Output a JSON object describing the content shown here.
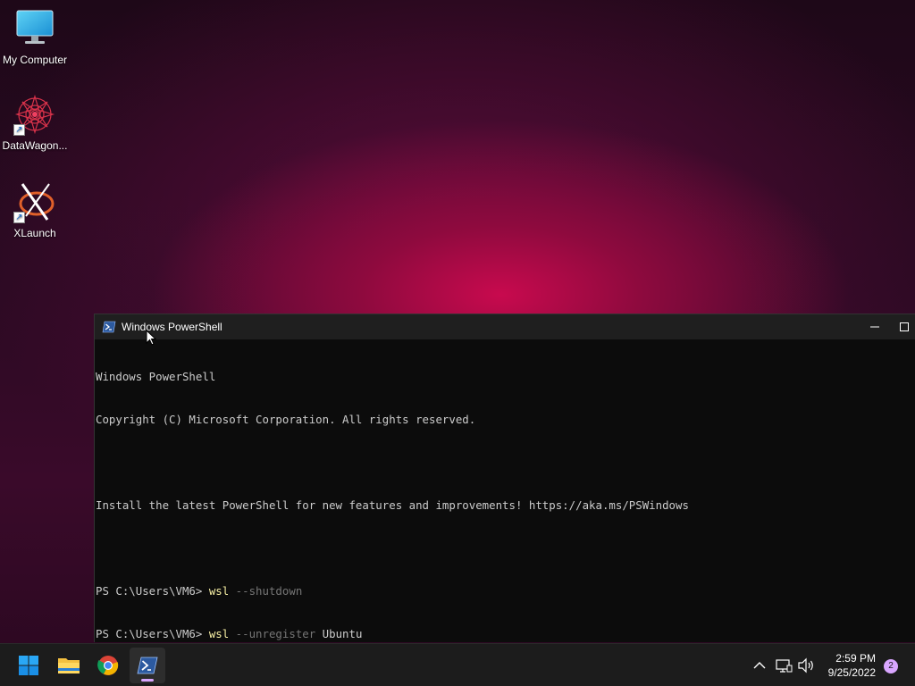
{
  "desktop": {
    "icons": [
      {
        "label": "My Computer",
        "icon": "monitor-icon"
      },
      {
        "label": "DataWagon...",
        "icon": "mandala-icon"
      },
      {
        "label": "XLaunch",
        "icon": "xlaunch-icon"
      }
    ]
  },
  "window": {
    "title": "Windows PowerShell",
    "minimize_glyph": "—",
    "maximize_glyph": "☐"
  },
  "console": {
    "lines": [
      "Windows PowerShell",
      "Copyright (C) Microsoft Corporation. All rights reserved.",
      "",
      "Install the latest PowerShell for new features and improvements! https://aka.ms/PSWindows",
      ""
    ],
    "commands": [
      {
        "prompt": "PS C:\\Users\\VM6> ",
        "cmd": "wsl",
        "arg": " --shutdown",
        "value": ""
      },
      {
        "prompt": "PS C:\\Users\\VM6> ",
        "cmd": "wsl",
        "arg": " --unregister",
        "value": " Ubuntu"
      }
    ]
  },
  "taskbar": {
    "apps": [
      "start-icon",
      "file-explorer-icon",
      "chrome-icon",
      "powershell-icon"
    ],
    "tray": {
      "chevron": "^",
      "time": "2:59 PM",
      "date": "9/25/2022",
      "notification_count": "2"
    }
  },
  "colors": {
    "accent": "#d9a6ff",
    "console_bg": "#0c0c0c",
    "command": "#f9f1a5",
    "argument": "#767676"
  }
}
